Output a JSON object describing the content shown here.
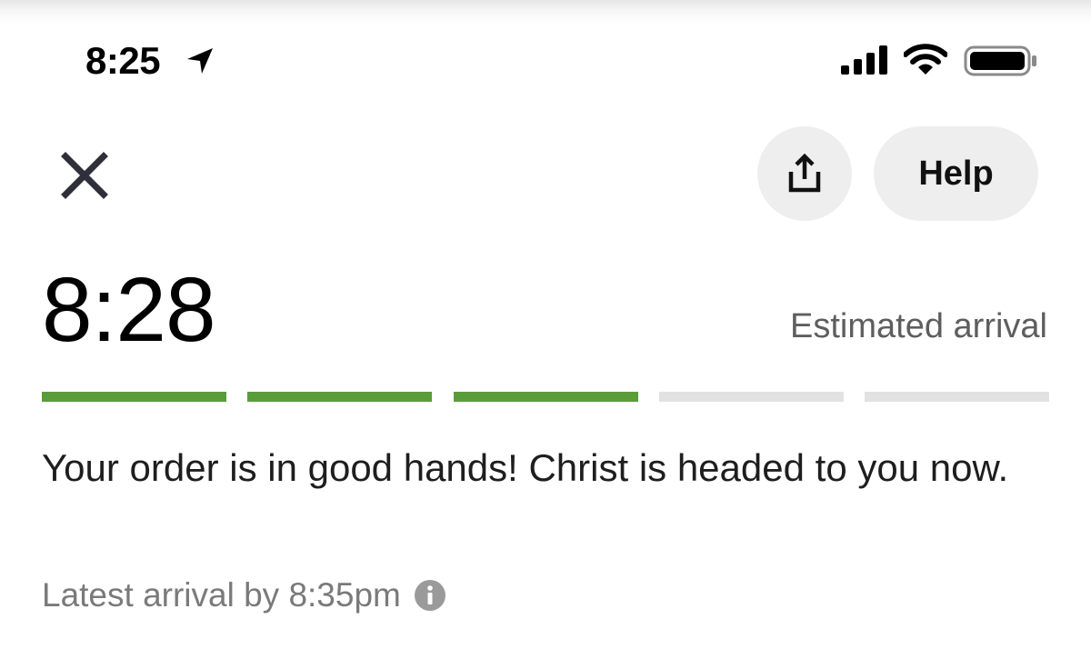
{
  "status_bar": {
    "time": "8:25"
  },
  "header": {
    "help_label": "Help"
  },
  "eta": {
    "time": "8:28",
    "label": "Estimated arrival"
  },
  "progress": {
    "steps_total": 5,
    "steps_completed": 3,
    "completed_color": "#5a9c3a",
    "pending_color": "#e2e2e2"
  },
  "message": {
    "text": "Your order is in good hands! Christ is headed to you now.",
    "latest_arrival": "Latest arrival by 8:35pm"
  },
  "icons": {
    "status": [
      "location-arrow-icon",
      "cellular-signal-icon",
      "wifi-icon",
      "battery-icon"
    ],
    "header": [
      "close-icon",
      "share-icon"
    ],
    "latest_arrival": "info-icon"
  }
}
